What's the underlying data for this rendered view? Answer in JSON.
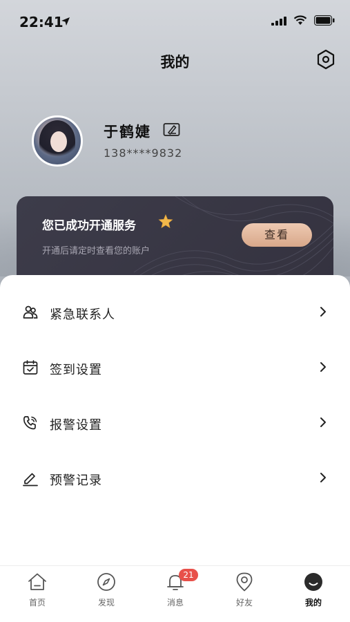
{
  "status_bar": {
    "time": "22:41",
    "icons": [
      "location-arrow-icon",
      "signal-icon",
      "wifi-icon",
      "battery-icon"
    ]
  },
  "header": {
    "title": "我的",
    "settings_icon": "settings-hexagon-icon"
  },
  "profile": {
    "name": "于鹤婕",
    "phone": "138****9832",
    "edit_icon": "edit-card-icon"
  },
  "service_card": {
    "title": "您已成功开通服务",
    "subtitle": "开通后请定时查看您的账户",
    "button_label": "查看",
    "accent_color": "#e3b696",
    "background_color": "#3a3946"
  },
  "menu": {
    "items": [
      {
        "label": "紧急联系人",
        "icon": "contacts-icon"
      },
      {
        "label": "签到设置",
        "icon": "calendar-check-icon"
      },
      {
        "label": "报警设置",
        "icon": "phone-alarm-icon"
      },
      {
        "label": "预警记录",
        "icon": "pen-record-icon"
      }
    ]
  },
  "tabbar": {
    "tabs": [
      {
        "label": "首页",
        "icon": "home-icon"
      },
      {
        "label": "发现",
        "icon": "compass-icon"
      },
      {
        "label": "消息",
        "icon": "bell-icon",
        "badge": "21"
      },
      {
        "label": "好友",
        "icon": "location-pin-icon"
      },
      {
        "label": "我的",
        "icon": "profile-face-icon",
        "active": true
      }
    ],
    "badge_color": "#e8504a"
  }
}
